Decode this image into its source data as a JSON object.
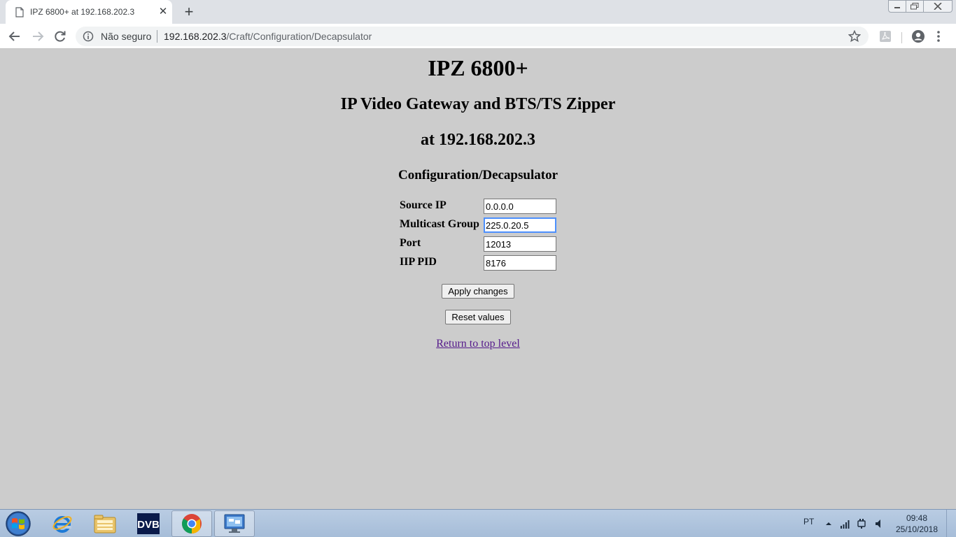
{
  "browser": {
    "tab_title": "IPZ 6800+ at 192.168.202.3",
    "security_label": "Não seguro",
    "url_host": "192.168.202.3",
    "url_path": "/Craft/Configuration/Decapsulator"
  },
  "page": {
    "title": "IPZ 6800+",
    "subtitle": "IP Video Gateway and BTS/TS Zipper",
    "address_line": "at 192.168.202.3",
    "section_heading": "Configuration/Decapsulator",
    "fields": [
      {
        "label": "Source IP",
        "value": "0.0.0.0"
      },
      {
        "label": "Multicast Group",
        "value": "225.0.20.5"
      },
      {
        "label": "Port",
        "value": "12013"
      },
      {
        "label": "IIP PID",
        "value": "8176"
      }
    ],
    "apply_button": "Apply changes",
    "reset_button": "Reset values",
    "top_link": "Return to top level"
  },
  "taskbar": {
    "apps": [
      "start-orb",
      "internet-explorer-icon",
      "file-explorer-icon",
      "dvb-app-icon",
      "chrome-icon",
      "remote-desktop-icon"
    ],
    "tray_language": "PT",
    "time": "09:48",
    "date": "25/10/2018"
  },
  "colors": {
    "page_background": "#cccccc",
    "link_visited": "#551a8b",
    "focus_ring": "#4d90fe",
    "taskbar": "#b9cce3"
  }
}
